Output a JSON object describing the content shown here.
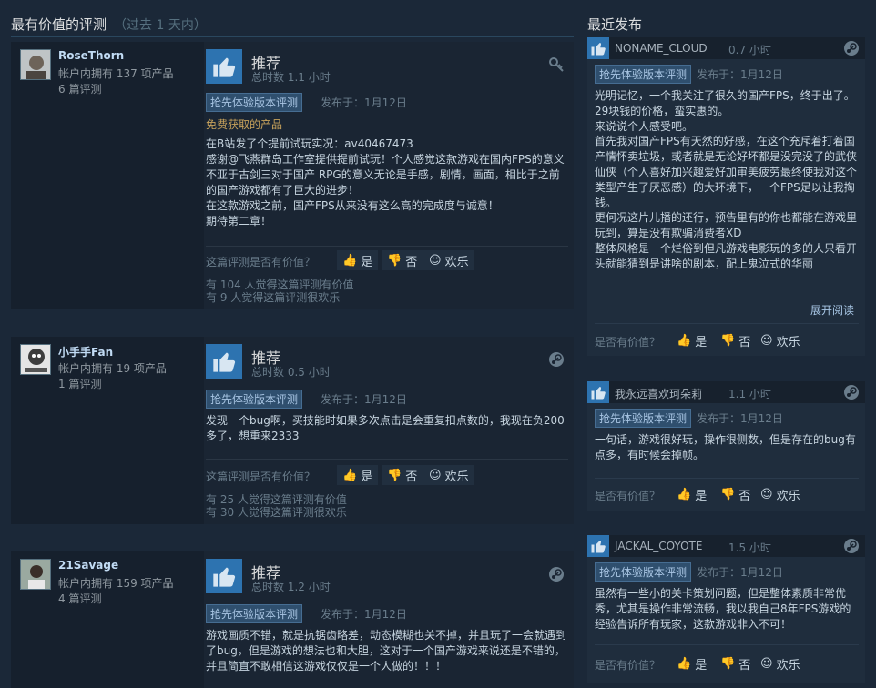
{
  "left": {
    "title": "最有价值的评测",
    "subtitle": "（过去 1 天内）",
    "helpful_question": "这篇评测是否有价值？",
    "yes_label": "是",
    "no_label": "否",
    "funny_label": "欢乐",
    "reviews": [
      {
        "author": "RoseThorn",
        "games_owned": "帐户内拥有 137 项产品",
        "review_count": "6 篇评测",
        "recommend": "推荐",
        "playtime": "总时数 1.1 小时",
        "badge": "抢先体验版本评测",
        "posted": "发布于：1月12日",
        "free_label": "免费获取的产品",
        "body": "在B站发了个提前试玩实况：av40467473\n感谢@飞燕群岛工作室提供提前试玩！个人感觉这款游戏在国内FPS的意义不亚于古剑三对于国产 RPG的意义无论是手感，剧情，画面，相比于之前的国产游戏都有了巨大的进步！\n在这款游戏之前，国产FPS从来没有这么高的完成度与诚意！\n期待第二章！",
        "helpful_stat": "有 104 人觉得这篇评测有价值",
        "funny_stat": "有 9 人觉得这篇评测很欢乐"
      },
      {
        "author": "小手手Fan",
        "games_owned": "帐户内拥有 19 项产品",
        "review_count": "1 篇评测",
        "recommend": "推荐",
        "playtime": "总时数 0.5 小时",
        "badge": "抢先体验版本评测",
        "posted": "发布于：1月12日",
        "body": "发现一个bug啊，买技能时如果多次点击是会重复扣点数的，我现在负200多了，想重来2333",
        "helpful_stat": "有 25 人觉得这篇评测有价值",
        "funny_stat": "有 30 人觉得这篇评测很欢乐"
      },
      {
        "author": "21Savage",
        "games_owned": "帐户内拥有 159 项产品",
        "review_count": "4 篇评测",
        "recommend": "推荐",
        "playtime": "总时数 1.2 小时",
        "badge": "抢先体验版本评测",
        "posted": "发布于：1月12日",
        "body": "游戏画质不错，就是抗锯齿略差，动态模糊也关不掉，并且玩了一会就遇到了bug，但是游戏的想法也和大胆，这对于一个国产游戏来说还是不错的，并且简直不敢相信这游戏仅仅是一个人做的！！！"
      }
    ]
  },
  "right": {
    "title": "最近发布",
    "helpful_question": "是否有价值？",
    "yes_label": "是",
    "no_label": "否",
    "funny_label": "欢乐",
    "read_more": "展开阅读",
    "items": [
      {
        "name": "NONAME_CLOUD",
        "time": "0.7 小时",
        "badge": "抢先体验版本评测",
        "posted": "发布于：1月12日",
        "body": "光明记忆，一个我关注了很久的国产FPS，终于出了。\n29块钱的价格，蛮实惠的。\n来说说个人感受吧。\n首先我对国产FPS有天然的好感，在这个充斥着打着国产情怀卖垃圾，或者就是无论好坏都是没完没了的武侠仙侠（个人喜好加兴趣爱好加审美疲劳最终使我对这个类型产生了厌恶感）的大环境下，一个FPS足以让我掏钱。\n更何况这片儿播的还行，预告里有的你也都能在游戏里玩到，算是没有欺骗消费者XD\n整体风格是一个烂俗到但凡游戏电影玩的多的人只看开头就能猜到是讲啥的剧本，配上鬼泣式的华丽"
      },
      {
        "name": "我永远喜欢珂朵莉",
        "time": "1.1 小时",
        "badge": "抢先体验版本评测",
        "posted": "发布于：1月12日",
        "body": "一句话，游戏很好玩，操作很侧数，但是存在的bug有点多，有时候会掉帧。"
      },
      {
        "name": "JACKAL_COYOTE",
        "time": "1.5 小时",
        "badge": "抢先体验版本评测",
        "posted": "发布于：1月12日",
        "body": "虽然有一些小的关卡策划问题，但是整体素质非常优秀，尤其是操作非常流畅，我以我自己8年FPS游戏的经验告诉所有玩家，这款游戏非入不可！"
      }
    ]
  }
}
